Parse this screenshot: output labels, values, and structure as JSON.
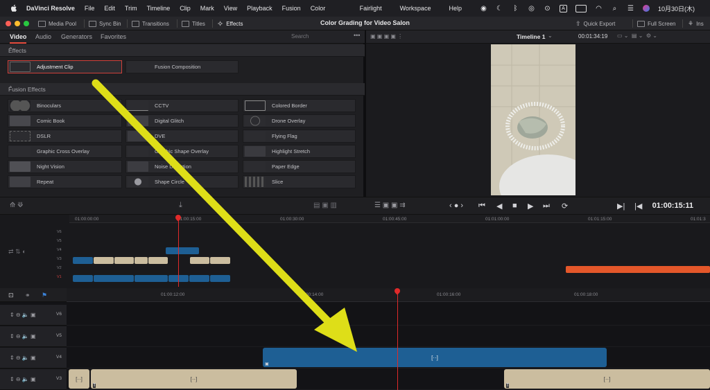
{
  "menubar": {
    "app_name": "DaVinci Resolve",
    "items": [
      "File",
      "Edit",
      "Trim",
      "Timeline",
      "Clip",
      "Mark",
      "View",
      "Playback",
      "Fusion",
      "Color"
    ],
    "right_items": [
      "Fairlight",
      "Workspace",
      "Help"
    ],
    "date": "10月30日(木)"
  },
  "toolbar": {
    "media_pool": "Media Pool",
    "sync_bin": "Sync Bin",
    "transitions": "Transitions",
    "titles": "Titles",
    "effects": "Effects",
    "project_title": "Color Grading for Video Salon",
    "quick_export": "Quick Export",
    "full_screen": "Full Screen",
    "inspector": "Ins"
  },
  "effects_panel": {
    "tabs": [
      "Video",
      "Audio",
      "Generators",
      "Favorites"
    ],
    "search_placeholder": "Search",
    "section_effects": "Effects",
    "section_fusion": "Fusion Effects",
    "effects_items": [
      "Adjustment Clip",
      "Fusion Composition"
    ],
    "fusion_items": [
      [
        "Binoculars",
        "CCTV",
        "Colored Border"
      ],
      [
        "Comic Book",
        "Digital Glitch",
        "Drone Overlay"
      ],
      [
        "DSLR",
        "DVE",
        "Flying Flag"
      ],
      [
        "Graphic Cross Overlay",
        "Graphic Shape Overlay",
        "Highlight Stretch"
      ],
      [
        "Night Vision",
        "Noise Distortion",
        "Paper Edge"
      ],
      [
        "Repeat",
        "Shape Circle",
        "Slice"
      ]
    ]
  },
  "viewer": {
    "timeline_name": "Timeline 1",
    "timecode_top": "00:01:34:19",
    "timecode_current": "01:00:15:11"
  },
  "mini_timeline": {
    "ruler": [
      "01:00:00:00",
      "01:00:15:00",
      "01:00:30:00",
      "01:00:45:00",
      "01:01:00:00",
      "01:01:15:00",
      "01:01:3"
    ],
    "tracks": [
      "V6",
      "V5",
      "V4",
      "V3",
      "V2",
      "V1"
    ]
  },
  "main_timeline": {
    "ruler": [
      "01:00:12:00",
      "01:00:14:00",
      "01:00:16:00",
      "01:00:18:00"
    ],
    "tracks": [
      "V6",
      "V5",
      "V4",
      "V3"
    ],
    "clip_glyph": "[··]"
  },
  "colors": {
    "accent_red": "#e64b3c",
    "clip_blue": "#1e5f94",
    "clip_tan": "#cbbd9f",
    "clip_orange": "#e4572a",
    "arrow_yellow": "#dede18"
  }
}
